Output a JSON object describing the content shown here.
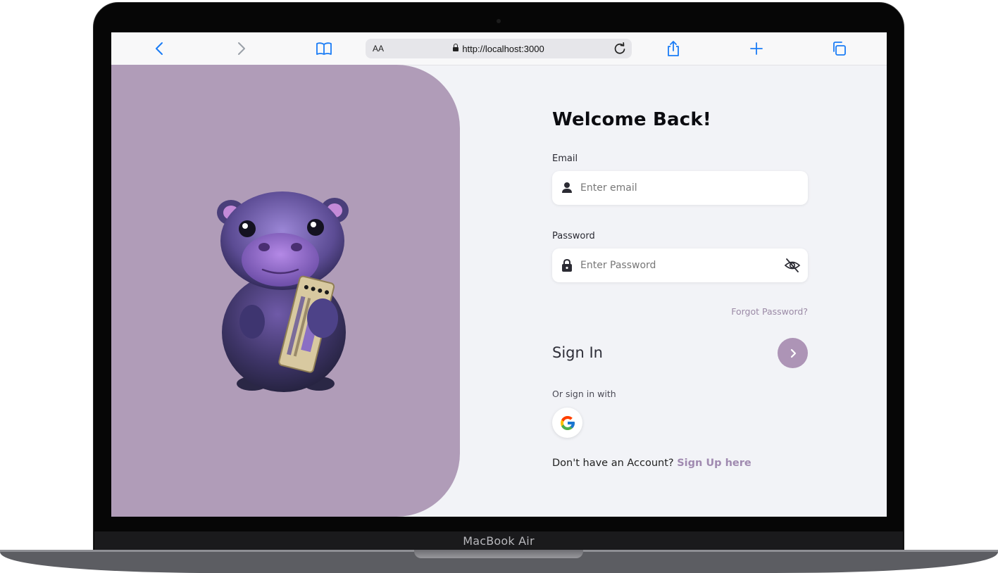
{
  "device": {
    "label": "MacBook Air"
  },
  "browser": {
    "text_size_label": "AA",
    "url": "http://localhost:3000",
    "accent_color": "#1a7cf5"
  },
  "login": {
    "title": "Welcome Back!",
    "email": {
      "label": "Email",
      "placeholder": "Enter email",
      "value": ""
    },
    "password": {
      "label": "Password",
      "placeholder": "Enter Password",
      "value": ""
    },
    "forgot_link": "Forgot Password?",
    "sign_in_label": "Sign In",
    "or_sign_in_with": "Or sign in with",
    "no_account_text": "Don't have an Account?",
    "sign_up_link": "Sign Up here"
  },
  "colors": {
    "panel": "#b09cb8",
    "accent": "#ad94b6",
    "link": "#a08ab0"
  },
  "icons": [
    "back-chevron-icon",
    "forward-chevron-icon",
    "bookmarks-book-icon",
    "lock-icon",
    "reload-icon",
    "share-icon",
    "plus-icon",
    "tabs-icon",
    "user-icon",
    "padlock-icon",
    "eye-slash-icon",
    "chevron-right-icon",
    "google-logo-icon"
  ]
}
